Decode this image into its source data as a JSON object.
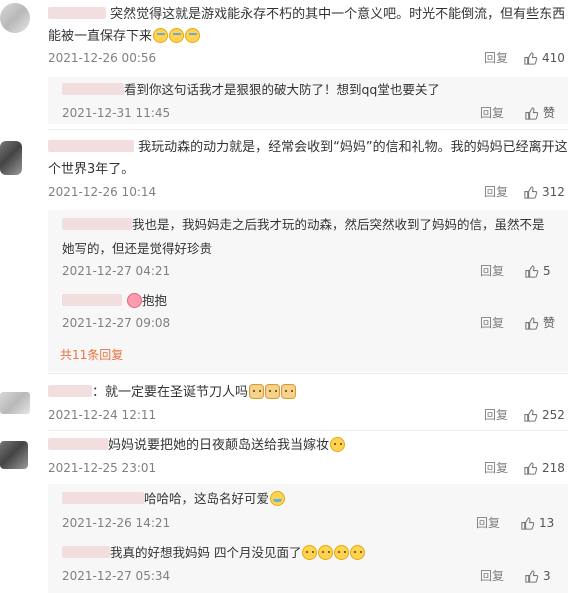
{
  "labels": {
    "reply": "回复",
    "like_word": "赞",
    "more_replies": "共11条回复"
  },
  "comments": [
    {
      "text": "突然觉得这就是游戏能永存不朽的其中一个意义吧。时光不能倒流，但有些东西能被一直保存下来",
      "time": "2021-12-26 00:56",
      "likes": "410"
    },
    {
      "text": "我玩动森的动力就是，经常会收到“妈妈”的信和礼物。我的妈妈已经离开这个世界3年了。",
      "time": "2021-12-26 10:14",
      "likes": "312"
    },
    {
      "text": "：就一定要在圣诞节刀人吗",
      "time": "2021-12-24 12:11",
      "likes": "252"
    },
    {
      "text": "妈妈说要把她的日夜颠岛送给我当嫁妆",
      "time": "2021-12-25 23:01",
      "likes": "218"
    }
  ],
  "replies": [
    {
      "text": "看到你这句话我才是狠狠的破大防了！想到qq堂也要关了",
      "time": "2021-12-31 11:45",
      "likes": ""
    },
    {
      "text": "我也是，我妈妈走之后我才玩的动森，然后突然收到了妈妈的信，虽然不是她写的，但还是觉得好珍贵",
      "time": "2021-12-27 04:21",
      "likes": "5"
    },
    {
      "text": "抱抱",
      "time": "2021-12-27 09:08",
      "likes": ""
    },
    {
      "text": "哈哈哈，这岛名好可爱",
      "time": "2021-12-26 14:21",
      "likes": "13"
    },
    {
      "text": "我真的好想我妈妈 四个月没见面了",
      "time": "2021-12-27 05:34",
      "likes": "3"
    }
  ]
}
